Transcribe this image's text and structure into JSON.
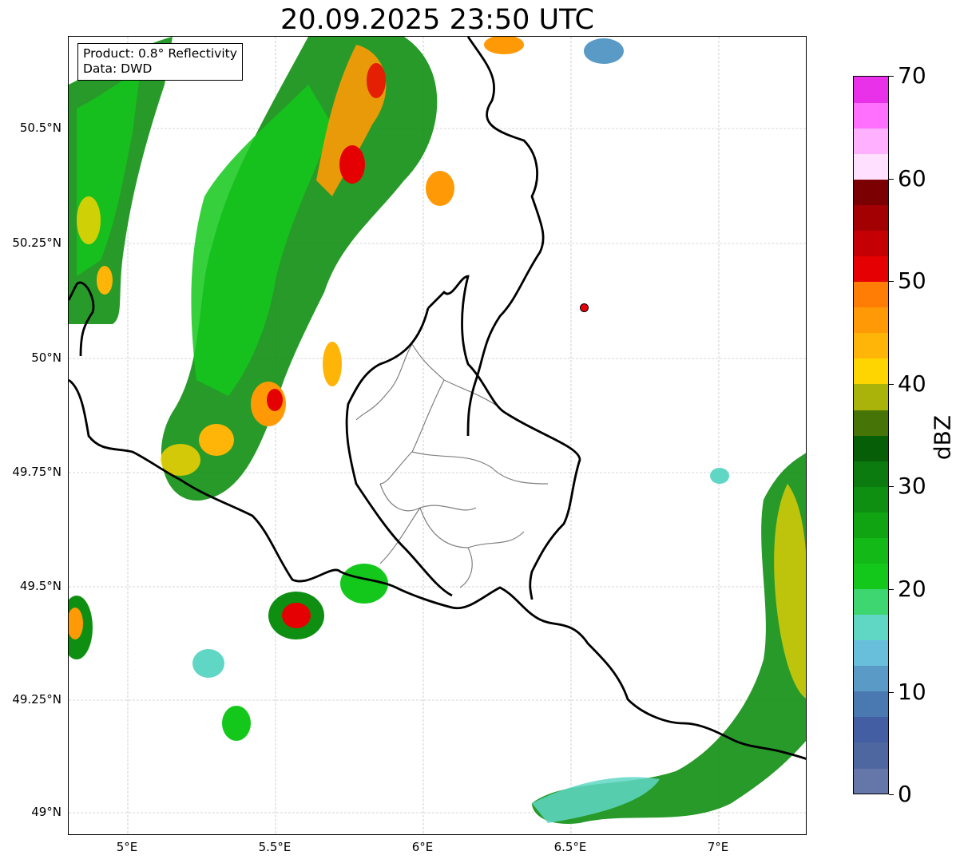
{
  "title": "20.09.2025 23:50 UTC",
  "info_box": {
    "product": "Product: 0.8° Reflectivity",
    "data": "Data: DWD"
  },
  "axes": {
    "lat_ticks": [
      "50.5°N",
      "50.25°N",
      "50°N",
      "49.75°N",
      "49.5°N",
      "49.25°N",
      "49°N"
    ],
    "lon_ticks": [
      "5°E",
      "5.5°E",
      "6°E",
      "6.5°E",
      "7°E"
    ]
  },
  "colorbar": {
    "label": "dBZ",
    "ticks": [
      "0",
      "10",
      "20",
      "30",
      "40",
      "50",
      "60",
      "70"
    ],
    "colors": [
      "#6577a9",
      "#4f67a0",
      "#435ea3",
      "#4a78b1",
      "#5a9ac6",
      "#67bfdc",
      "#5fd7c4",
      "#3dd670",
      "#14c81b",
      "#13b916",
      "#10a413",
      "#0f8f12",
      "#0b7a0f",
      "#065e07",
      "#477407",
      "#a9b309",
      "#ffd500",
      "#ffb507",
      "#ff9a06",
      "#ff7d05",
      "#e40003",
      "#c40004",
      "#a30003",
      "#7b0002",
      "#ffe1ff",
      "#ffb1ff",
      "#ff70ff",
      "#ea31ea"
    ]
  },
  "radar_site": {
    "lat": 50.11,
    "lon": 6.55,
    "color": "#e8000b"
  },
  "map_colors": {
    "country_border": "#000000",
    "region_border": "#808080",
    "gridline": "#b0b0b0"
  }
}
